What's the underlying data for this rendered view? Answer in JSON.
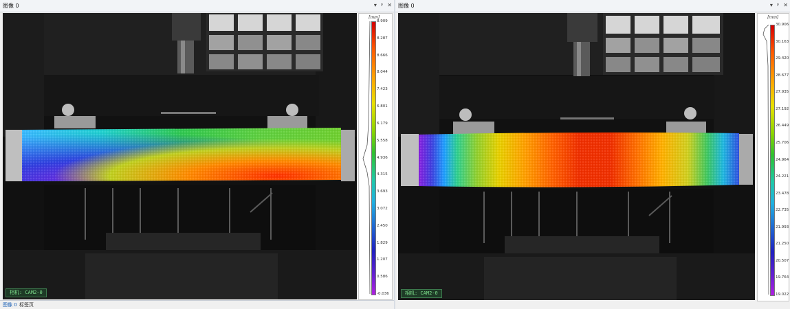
{
  "windows": [
    {
      "title": "图像 0",
      "controls": {
        "pin": "▾",
        "float": "ᵖ",
        "close": "✕"
      },
      "camera_label": "相机: CAM2-0",
      "legend": {
        "unit": "[mm]",
        "ticks": [
          "8.909",
          "8.287",
          "8.666",
          "8.044",
          "7.423",
          "6.801",
          "6.179",
          "5.558",
          "4.936",
          "4.315",
          "3.693",
          "3.072",
          "2.450",
          "1.829",
          "1.207",
          "0.586",
          "-0.036"
        ]
      }
    },
    {
      "title": "图像 0",
      "controls": {
        "pin": "▾",
        "float": "ᵖ",
        "close": "✕"
      },
      "camera_label": "相机: CAM2-0",
      "legend": {
        "unit": "[mm]",
        "ticks": [
          "30.906",
          "30.163",
          "29.420",
          "28.677",
          "27.935",
          "27.192",
          "26.449",
          "25.706",
          "24.964",
          "24.221",
          "23.478",
          "22.735",
          "21.993",
          "21.250",
          "20.507",
          "19.764",
          "19.022"
        ]
      }
    }
  ],
  "bottom_tabs": [
    {
      "label": "图像 0",
      "active": true
    },
    {
      "label": "标签页",
      "active": false
    }
  ],
  "colors": {
    "panel_bg": "#f0f0f0",
    "viewport_bg": "#0d0d0d",
    "camera_tag_text": "#7fe08d",
    "tab_active": "#1a5fb4"
  }
}
